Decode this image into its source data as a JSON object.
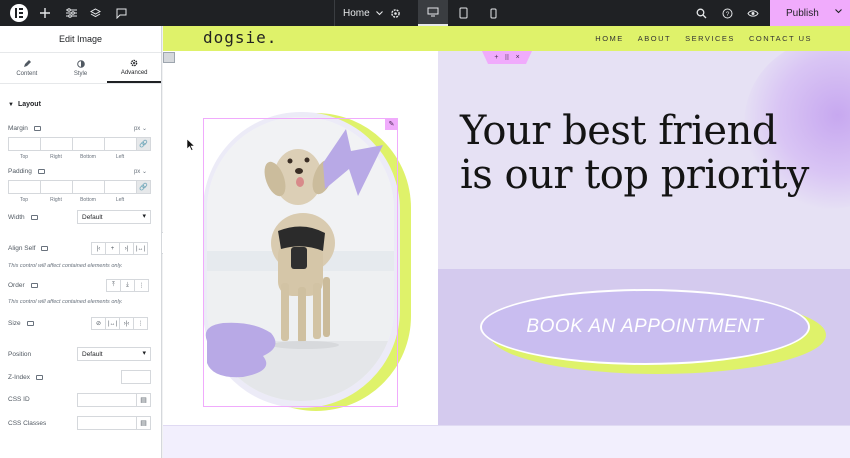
{
  "topbar": {
    "page_selector": "Home",
    "publish_label": "Publish"
  },
  "panel": {
    "title": "Edit Image",
    "tabs": [
      {
        "label": "Content",
        "icon": "pencil-icon"
      },
      {
        "label": "Style",
        "icon": "contrast-icon"
      },
      {
        "label": "Advanced",
        "icon": "gear-icon",
        "active": true
      }
    ],
    "layout_section": "Layout",
    "margin": {
      "label": "Margin",
      "unit": "px ⌄",
      "sides": [
        "Top",
        "Right",
        "Bottom",
        "Left"
      ]
    },
    "padding": {
      "label": "Padding",
      "unit": "px ⌄",
      "sides": [
        "Top",
        "Right",
        "Bottom",
        "Left"
      ]
    },
    "width": {
      "label": "Width",
      "value": "Default"
    },
    "align_self": {
      "label": "Align Self",
      "note": "This control will affect contained elements only."
    },
    "order": {
      "label": "Order",
      "note": "This control will affect contained elements only."
    },
    "size": {
      "label": "Size"
    },
    "position": {
      "label": "Position",
      "value": "Default"
    },
    "z_index": {
      "label": "Z-Index"
    },
    "css_id": {
      "label": "CSS ID"
    },
    "css_classes": {
      "label": "CSS Classes"
    }
  },
  "site": {
    "brand": "dogsie.",
    "nav": [
      "HOME",
      "ABOUT",
      "SERVICES",
      "CONTACT US"
    ],
    "hero_line1": "Your best friend",
    "hero_line2": "is our top priority",
    "cta": "BOOK AN APPOINTMENT"
  },
  "colors": {
    "accent_pink": "#f0abfc",
    "lime": "#dff26a",
    "lavender": "#c9bdf0",
    "lavender_bg": "#e6e1f4",
    "dark_bar": "#1f2124"
  }
}
